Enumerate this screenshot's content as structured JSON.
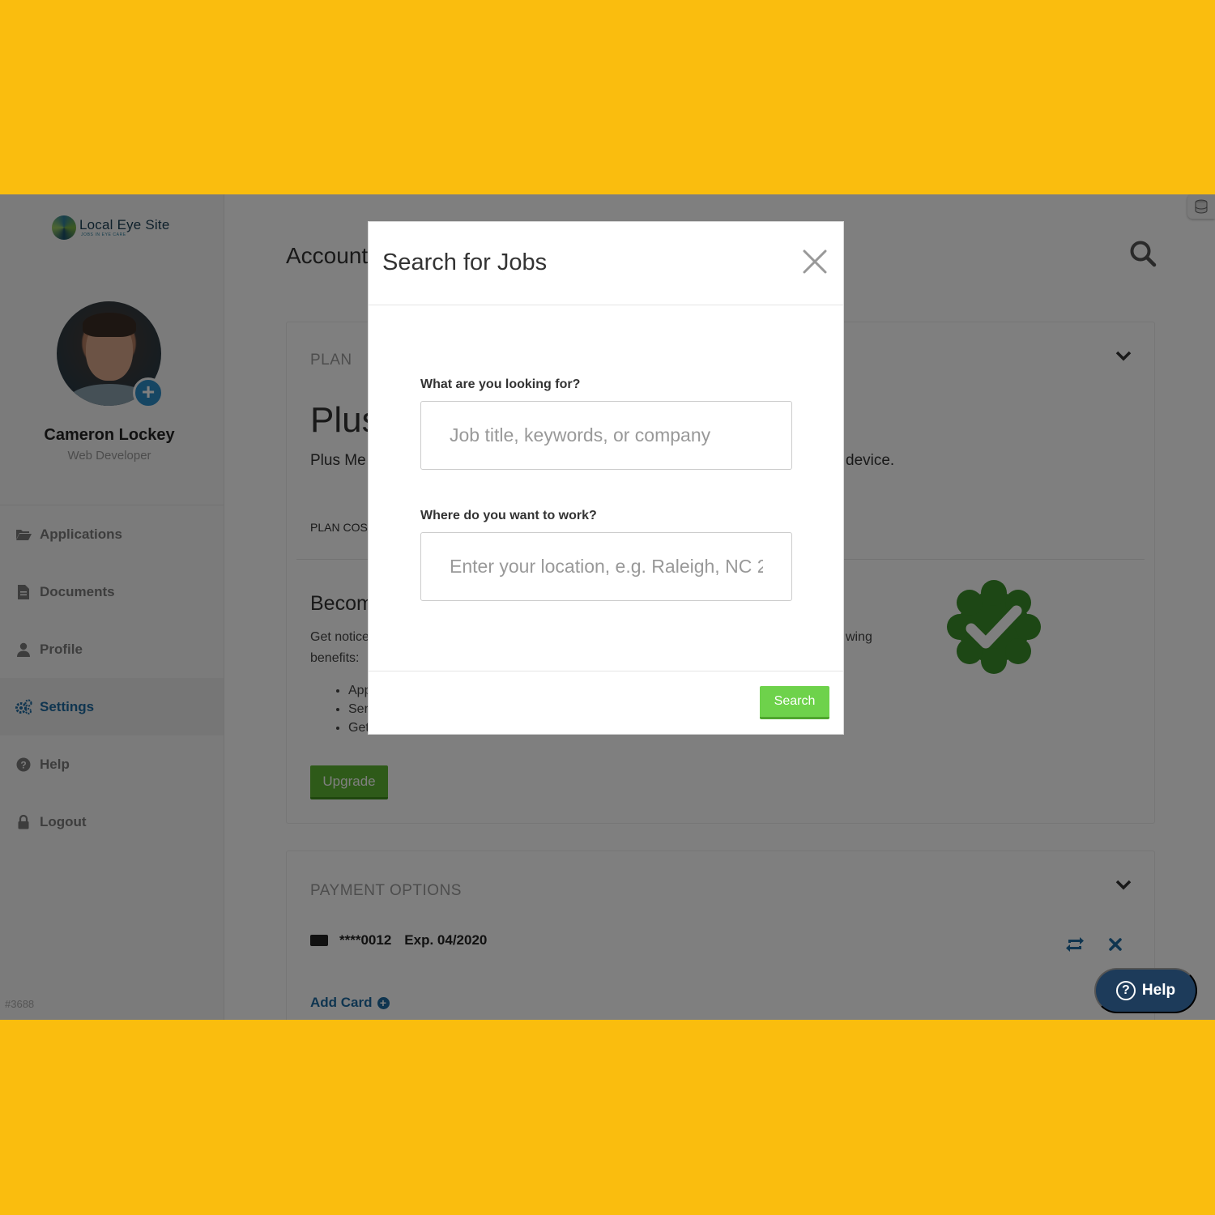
{
  "brand": {
    "name": "Local Eye Site",
    "tagline": "JOBS IN EYE CARE"
  },
  "user": {
    "name": "Cameron Lockey",
    "role": "Web Developer"
  },
  "nav": [
    {
      "label": "Applications",
      "icon": "folder-open-icon"
    },
    {
      "label": "Documents",
      "icon": "document-icon"
    },
    {
      "label": "Profile",
      "icon": "user-icon"
    },
    {
      "label": "Settings",
      "icon": "gears-icon",
      "active": true
    },
    {
      "label": "Help",
      "icon": "question-circle-icon"
    },
    {
      "label": "Logout",
      "icon": "lock-icon"
    }
  ],
  "build": "#3688",
  "page": {
    "title": "Account"
  },
  "plan": {
    "section_label": "PLAN",
    "name": "Plus",
    "description": "Plus Me",
    "description_tail": "device.",
    "cost_label": "PLAN COST",
    "become": "Becom",
    "notice": "Get notice",
    "notice_tail": "wing",
    "benefits_label": "benefits:",
    "bullets": [
      "App",
      "Ser",
      "Get"
    ],
    "upgrade_label": "Upgrade"
  },
  "payment": {
    "section_label": "PAYMENT OPTIONS",
    "card_number": "****0012",
    "card_expiry": "Exp. 04/2020",
    "add_card_label": "Add Card"
  },
  "help_button": {
    "label": "Help"
  },
  "modal": {
    "title": "Search for Jobs",
    "what_label": "What are you looking for?",
    "what_placeholder": "Job title, keywords, or company",
    "where_label": "Where do you want to work?",
    "where_placeholder": "Enter your location, e.g. Raleigh, NC 2",
    "search_label": "Search"
  },
  "colors": {
    "frame": "#FABD0E",
    "accent_blue": "#1f6aa0",
    "upgrade_green": "#5cb532",
    "search_green": "#6ed24b",
    "badge_green": "#3a8f2a",
    "help_navy": "#1d3b5a"
  }
}
